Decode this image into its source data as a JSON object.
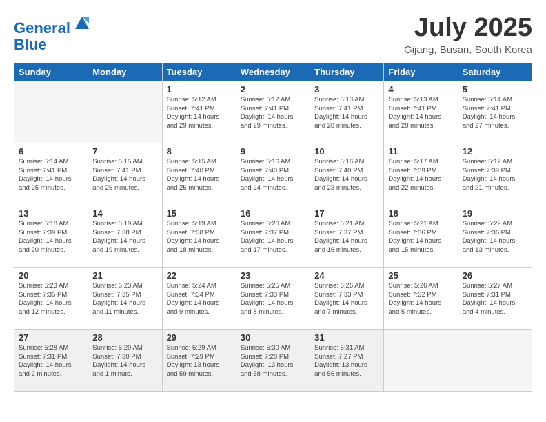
{
  "header": {
    "logo_line1": "General",
    "logo_line2": "Blue",
    "month": "July 2025",
    "location": "Gijang, Busan, South Korea"
  },
  "weekdays": [
    "Sunday",
    "Monday",
    "Tuesday",
    "Wednesday",
    "Thursday",
    "Friday",
    "Saturday"
  ],
  "weeks": [
    [
      {
        "day": "",
        "empty": true
      },
      {
        "day": "",
        "empty": true
      },
      {
        "day": "1",
        "sunrise": "Sunrise: 5:12 AM",
        "sunset": "Sunset: 7:41 PM",
        "daylight": "Daylight: 14 hours and 29 minutes."
      },
      {
        "day": "2",
        "sunrise": "Sunrise: 5:12 AM",
        "sunset": "Sunset: 7:41 PM",
        "daylight": "Daylight: 14 hours and 29 minutes."
      },
      {
        "day": "3",
        "sunrise": "Sunrise: 5:13 AM",
        "sunset": "Sunset: 7:41 PM",
        "daylight": "Daylight: 14 hours and 28 minutes."
      },
      {
        "day": "4",
        "sunrise": "Sunrise: 5:13 AM",
        "sunset": "Sunset: 7:41 PM",
        "daylight": "Daylight: 14 hours and 28 minutes."
      },
      {
        "day": "5",
        "sunrise": "Sunrise: 5:14 AM",
        "sunset": "Sunset: 7:41 PM",
        "daylight": "Daylight: 14 hours and 27 minutes."
      }
    ],
    [
      {
        "day": "6",
        "sunrise": "Sunrise: 5:14 AM",
        "sunset": "Sunset: 7:41 PM",
        "daylight": "Daylight: 14 hours and 26 minutes."
      },
      {
        "day": "7",
        "sunrise": "Sunrise: 5:15 AM",
        "sunset": "Sunset: 7:41 PM",
        "daylight": "Daylight: 14 hours and 25 minutes."
      },
      {
        "day": "8",
        "sunrise": "Sunrise: 5:15 AM",
        "sunset": "Sunset: 7:40 PM",
        "daylight": "Daylight: 14 hours and 25 minutes."
      },
      {
        "day": "9",
        "sunrise": "Sunrise: 5:16 AM",
        "sunset": "Sunset: 7:40 PM",
        "daylight": "Daylight: 14 hours and 24 minutes."
      },
      {
        "day": "10",
        "sunrise": "Sunrise: 5:16 AM",
        "sunset": "Sunset: 7:40 PM",
        "daylight": "Daylight: 14 hours and 23 minutes."
      },
      {
        "day": "11",
        "sunrise": "Sunrise: 5:17 AM",
        "sunset": "Sunset: 7:39 PM",
        "daylight": "Daylight: 14 hours and 22 minutes."
      },
      {
        "day": "12",
        "sunrise": "Sunrise: 5:17 AM",
        "sunset": "Sunset: 7:39 PM",
        "daylight": "Daylight: 14 hours and 21 minutes."
      }
    ],
    [
      {
        "day": "13",
        "sunrise": "Sunrise: 5:18 AM",
        "sunset": "Sunset: 7:39 PM",
        "daylight": "Daylight: 14 hours and 20 minutes."
      },
      {
        "day": "14",
        "sunrise": "Sunrise: 5:19 AM",
        "sunset": "Sunset: 7:38 PM",
        "daylight": "Daylight: 14 hours and 19 minutes."
      },
      {
        "day": "15",
        "sunrise": "Sunrise: 5:19 AM",
        "sunset": "Sunset: 7:38 PM",
        "daylight": "Daylight: 14 hours and 18 minutes."
      },
      {
        "day": "16",
        "sunrise": "Sunrise: 5:20 AM",
        "sunset": "Sunset: 7:37 PM",
        "daylight": "Daylight: 14 hours and 17 minutes."
      },
      {
        "day": "17",
        "sunrise": "Sunrise: 5:21 AM",
        "sunset": "Sunset: 7:37 PM",
        "daylight": "Daylight: 14 hours and 16 minutes."
      },
      {
        "day": "18",
        "sunrise": "Sunrise: 5:21 AM",
        "sunset": "Sunset: 7:36 PM",
        "daylight": "Daylight: 14 hours and 15 minutes."
      },
      {
        "day": "19",
        "sunrise": "Sunrise: 5:22 AM",
        "sunset": "Sunset: 7:36 PM",
        "daylight": "Daylight: 14 hours and 13 minutes."
      }
    ],
    [
      {
        "day": "20",
        "sunrise": "Sunrise: 5:23 AM",
        "sunset": "Sunset: 7:35 PM",
        "daylight": "Daylight: 14 hours and 12 minutes."
      },
      {
        "day": "21",
        "sunrise": "Sunrise: 5:23 AM",
        "sunset": "Sunset: 7:35 PM",
        "daylight": "Daylight: 14 hours and 11 minutes."
      },
      {
        "day": "22",
        "sunrise": "Sunrise: 5:24 AM",
        "sunset": "Sunset: 7:34 PM",
        "daylight": "Daylight: 14 hours and 9 minutes."
      },
      {
        "day": "23",
        "sunrise": "Sunrise: 5:25 AM",
        "sunset": "Sunset: 7:33 PM",
        "daylight": "Daylight: 14 hours and 8 minutes."
      },
      {
        "day": "24",
        "sunrise": "Sunrise: 5:26 AM",
        "sunset": "Sunset: 7:33 PM",
        "daylight": "Daylight: 14 hours and 7 minutes."
      },
      {
        "day": "25",
        "sunrise": "Sunrise: 5:26 AM",
        "sunset": "Sunset: 7:32 PM",
        "daylight": "Daylight: 14 hours and 5 minutes."
      },
      {
        "day": "26",
        "sunrise": "Sunrise: 5:27 AM",
        "sunset": "Sunset: 7:31 PM",
        "daylight": "Daylight: 14 hours and 4 minutes."
      }
    ],
    [
      {
        "day": "27",
        "sunrise": "Sunrise: 5:28 AM",
        "sunset": "Sunset: 7:31 PM",
        "daylight": "Daylight: 14 hours and 2 minutes.",
        "last": true
      },
      {
        "day": "28",
        "sunrise": "Sunrise: 5:29 AM",
        "sunset": "Sunset: 7:30 PM",
        "daylight": "Daylight: 14 hours and 1 minute.",
        "last": true
      },
      {
        "day": "29",
        "sunrise": "Sunrise: 5:29 AM",
        "sunset": "Sunset: 7:29 PM",
        "daylight": "Daylight: 13 hours and 59 minutes.",
        "last": true
      },
      {
        "day": "30",
        "sunrise": "Sunrise: 5:30 AM",
        "sunset": "Sunset: 7:28 PM",
        "daylight": "Daylight: 13 hours and 58 minutes.",
        "last": true
      },
      {
        "day": "31",
        "sunrise": "Sunrise: 5:31 AM",
        "sunset": "Sunset: 7:27 PM",
        "daylight": "Daylight: 13 hours and 56 minutes.",
        "last": true
      },
      {
        "day": "",
        "empty": true,
        "last": true
      },
      {
        "day": "",
        "empty": true,
        "last": true
      }
    ]
  ]
}
